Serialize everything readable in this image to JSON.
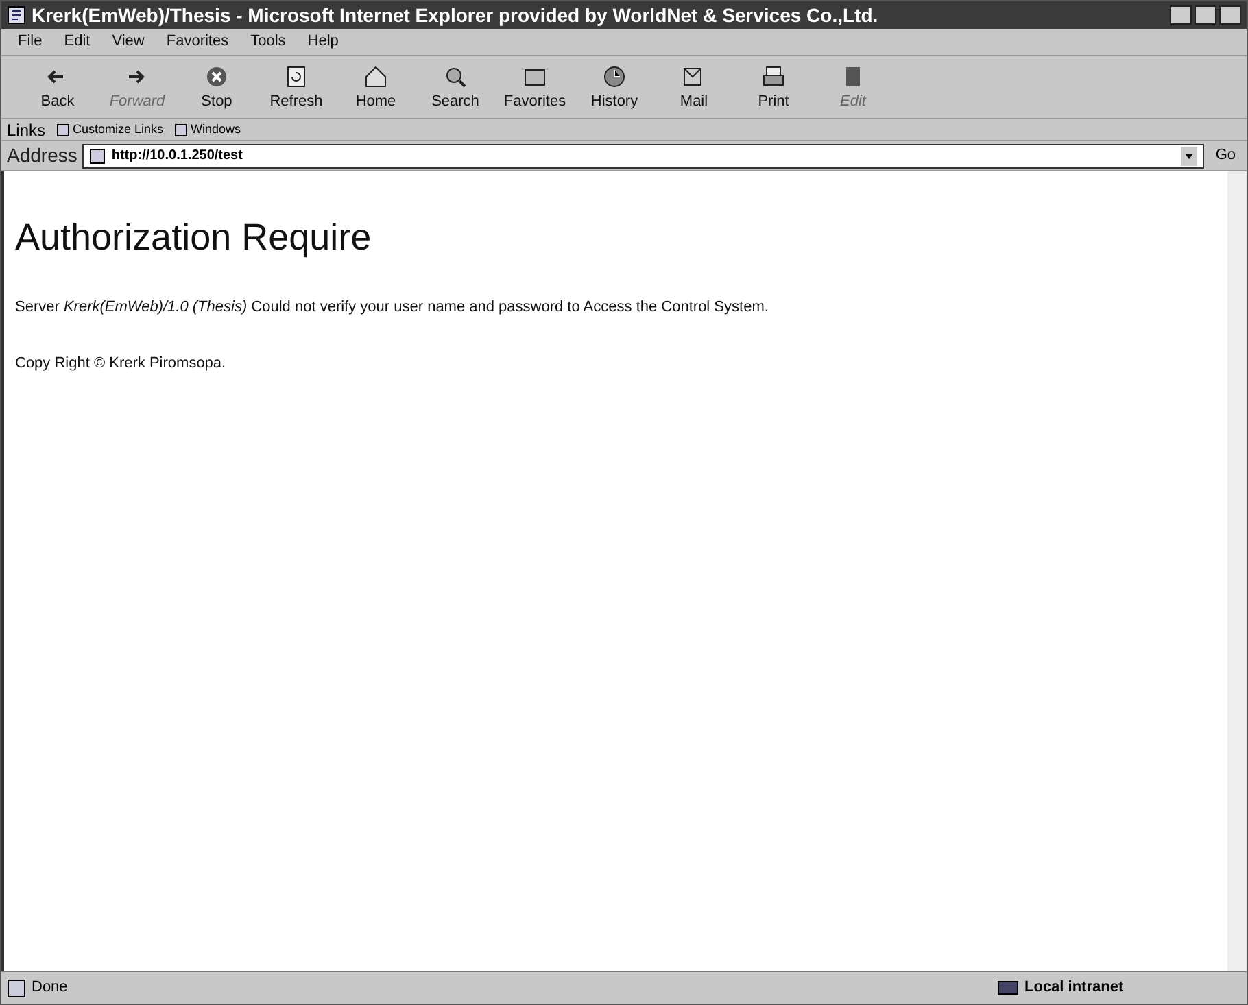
{
  "window": {
    "title": "Krerk(EmWeb)/Thesis - Microsoft Internet Explorer provided by WorldNet & Services Co.,Ltd."
  },
  "menu": [
    "File",
    "Edit",
    "View",
    "Favorites",
    "Tools",
    "Help"
  ],
  "toolbar": [
    {
      "label": "Back",
      "disabled": false
    },
    {
      "label": "Forward",
      "disabled": true
    },
    {
      "label": "Stop",
      "disabled": false
    },
    {
      "label": "Refresh",
      "disabled": false
    },
    {
      "label": "Home",
      "disabled": false
    },
    {
      "label": "Search",
      "disabled": false
    },
    {
      "label": "Favorites",
      "disabled": false
    },
    {
      "label": "History",
      "disabled": false
    },
    {
      "label": "Mail",
      "disabled": false
    },
    {
      "label": "Print",
      "disabled": false
    },
    {
      "label": "Edit",
      "disabled": true
    }
  ],
  "links": {
    "label": "Links",
    "items": [
      "Customize Links",
      "Windows"
    ]
  },
  "address": {
    "label": "Address",
    "value": "http://10.0.1.250/test",
    "go": "Go"
  },
  "page": {
    "heading": "Authorization Require",
    "message": "Server *Krerk(EmWeb)/1.0 (Thesis)* Could not verify your user name and password to Access the Control System.",
    "copyright": "Copy Right © Krerk Piromsopa."
  },
  "status_bar": {
    "text": "Done",
    "zone": "Local intranet"
  }
}
